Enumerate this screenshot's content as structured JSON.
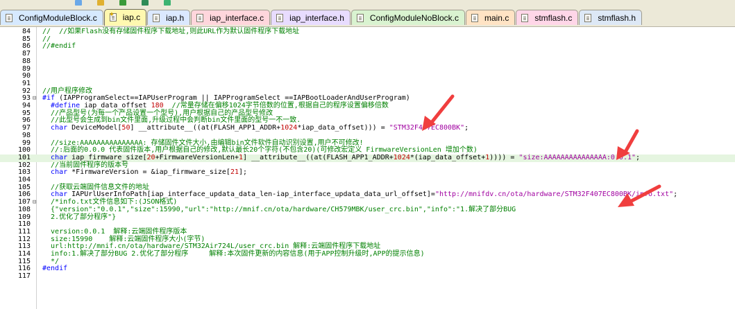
{
  "tabs": [
    {
      "label": "ConfigModuleBlock.c",
      "color": "#d6e9ff",
      "active": false
    },
    {
      "label": "iap.c",
      "color": "#fff8b0",
      "active": true
    },
    {
      "label": "iap.h",
      "color": "#dbe8ff",
      "active": false
    },
    {
      "label": "iap_interface.c",
      "color": "#ffd6dc",
      "active": false
    },
    {
      "label": "iap_interface.h",
      "color": "#e8dcff",
      "active": false
    },
    {
      "label": "ConfigModuleNoBlock.c",
      "color": "#d9f3d0",
      "active": false
    },
    {
      "label": "main.c",
      "color": "#ffe3c4",
      "active": false
    },
    {
      "label": "stmflash.c",
      "color": "#ffd6e8",
      "active": false
    },
    {
      "label": "stmflash.h",
      "color": "#dde8f6",
      "active": false
    }
  ],
  "toolbar_icon_colors": [
    "#6aa8e8",
    "#e0b030",
    "#3a9a3a",
    "#2e8b57",
    "#3cb371"
  ],
  "highlight_color": "#e5f5e0",
  "arrow_color": "#f03e3e",
  "lines": [
    {
      "n": "84",
      "fold": "",
      "code": "//  //如果Flash没有存储固件程序下载地址,则此URL作为默认固件程序下载地址",
      "cls": "cm"
    },
    {
      "n": "85",
      "fold": "",
      "code": "//",
      "cls": "cm"
    },
    {
      "n": "86",
      "fold": "",
      "code": "//#endif",
      "cls": "cm"
    },
    {
      "n": "87",
      "fold": "",
      "code": "",
      "cls": ""
    },
    {
      "n": "88",
      "fold": "",
      "code": "",
      "cls": ""
    },
    {
      "n": "89",
      "fold": "",
      "code": "",
      "cls": ""
    },
    {
      "n": "90",
      "fold": "",
      "code": "",
      "cls": ""
    },
    {
      "n": "91",
      "fold": "",
      "code": "",
      "cls": ""
    },
    {
      "n": "92",
      "fold": "",
      "code": "//用户程序修改",
      "cls": "cm"
    },
    {
      "n": "93",
      "fold": "⊟",
      "code": "#if (IAPProgramSelect==IAPUserProgram || IAPProgramSelect ==IAPBootLoaderAndUserProgram)",
      "cls": "mix93"
    },
    {
      "n": "94",
      "fold": "",
      "code": "  #define iap_data_offset 180  //常量存储在偏移1024字节倍数的位置,根据自己的程序设置偏移倍数",
      "cls": "mix94"
    },
    {
      "n": "95",
      "fold": "",
      "code": "  //产品型号(为每一个产品设置一个型号),用户根据自己的产品型号修改",
      "cls": "cm"
    },
    {
      "n": "96",
      "fold": "",
      "code": "  //此型号会生成到bin文件里面,升级过程中会判断bin文件里面的型号一不一致.",
      "cls": "cm"
    },
    {
      "n": "97",
      "fold": "",
      "code": "  char DeviceModel[50] __attribute__((at(FLASH_APP1_ADDR+1024*iap_data_offset))) = \"STM32F407EC800BK\";",
      "cls": "mix97"
    },
    {
      "n": "98",
      "fold": "",
      "code": "",
      "cls": ""
    },
    {
      "n": "99",
      "fold": "",
      "code": "  //size:AAAAAAAAAAAAAAA: 存储固件文件大小,由编辑bin文件软件自动识别设置,用户不可修改!",
      "cls": "cm"
    },
    {
      "n": "100",
      "fold": "",
      "code": "  //:后面的0.0.0 代表固件版本,用户根据自己的修改,默认最长20个字符(不包含20)(可修改宏定义 FirmwareVersionLen 增加个数)",
      "cls": "cm"
    },
    {
      "n": "101",
      "fold": "",
      "code": "  char iap_firmware_size[20+FirmwareVersionLen+1] __attribute__((at(FLASH_APP1_ADDR+1024*(iap_data_offset+1)))) = \"size:AAAAAAAAAAAAAAA:0.0.1\";",
      "cls": "mix101"
    },
    {
      "n": "102",
      "fold": "",
      "code": "  //当前固件程序的版本号",
      "cls": "cm"
    },
    {
      "n": "103",
      "fold": "",
      "code": "  char *FirmwareVersion = &iap_firmware_size[21];",
      "cls": "mix103"
    },
    {
      "n": "104",
      "fold": "",
      "code": "",
      "cls": ""
    },
    {
      "n": "105",
      "fold": "",
      "code": "  //获取云端固件信息文件的地址",
      "cls": "cm"
    },
    {
      "n": "106",
      "fold": "",
      "code": "  char IAPUrlUserInfoPath[iap_interface_updata_data_len-iap_interface_updata_data_url_offset]=\"http://mnifdv.cn/ota/hardware/STM32F407EC800BK/info.txt\";",
      "cls": "mix106"
    },
    {
      "n": "107",
      "fold": "⊟",
      "code": "  /*info.txt文件信息如下:(JSON格式)",
      "cls": "cm"
    },
    {
      "n": "108",
      "fold": "",
      "code": "  {\"version\":\"0.0.1\",\"size\":15990,\"url\":\"http://mnif.cn/ota/hardware/CH579MBK/user_crc.bin\",\"info\":\"1.解决了部分BUG",
      "cls": "cm"
    },
    {
      "n": "109",
      "fold": "",
      "code": "  2.优化了部分程序\"}",
      "cls": "cm"
    },
    {
      "n": "110",
      "fold": "",
      "code": "",
      "cls": ""
    },
    {
      "n": "111",
      "fold": "",
      "code": "  version:0.0.1  解释:云端固件程序版本",
      "cls": "cm"
    },
    {
      "n": "112",
      "fold": "",
      "code": "  size:15990    解释:云端固件程序大小(字节)",
      "cls": "cm"
    },
    {
      "n": "113",
      "fold": "",
      "code": "  url:http://mnif.cn/ota/hardware/STM32Air724L/user_crc.bin 解释:云端固件程序下载地址",
      "cls": "cm"
    },
    {
      "n": "114",
      "fold": "",
      "code": "  info:1.解决了部分BUG 2.优化了部分程序     解释:本次固件更新的内容信息(用于APP控制升级时,APP的提示信息)",
      "cls": "cm"
    },
    {
      "n": "115",
      "fold": "",
      "code": "  */",
      "cls": "cm"
    },
    {
      "n": "116",
      "fold": "",
      "code": "#endif",
      "cls": "pp"
    },
    {
      "n": "117",
      "fold": "",
      "code": "",
      "cls": ""
    }
  ]
}
